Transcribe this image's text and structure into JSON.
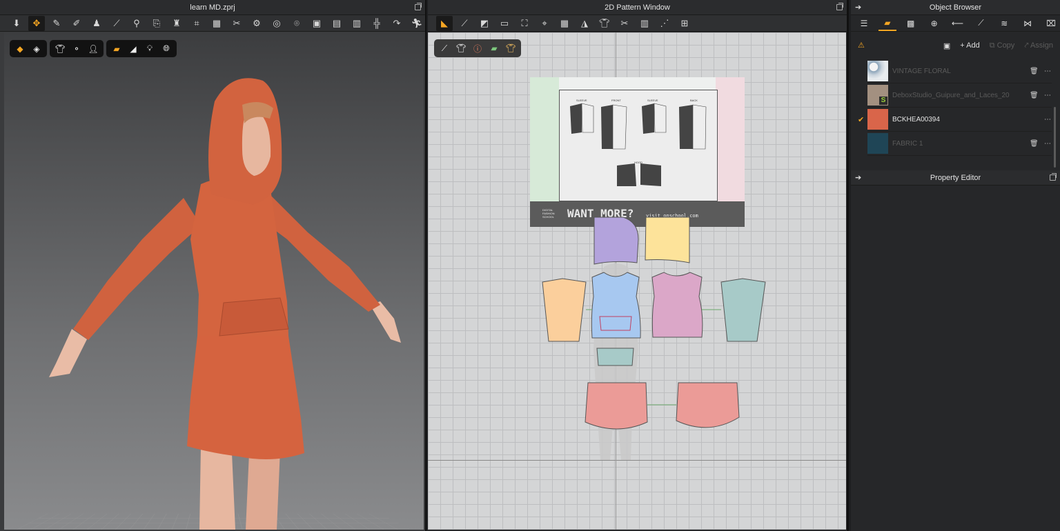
{
  "left_window": {
    "title": "learn MD.zprj"
  },
  "middle_window": {
    "title": "2D Pattern Window"
  },
  "object_browser": {
    "title": "Object Browser",
    "actions": {
      "add": "Add",
      "copy": "Copy",
      "assign": "Assign"
    },
    "fabrics": [
      {
        "name": "VINTAGE FLORAL",
        "color": "#c9d3dc",
        "selected": false
      },
      {
        "name": "DeboxStudio_Guipure_and_Laces_20",
        "color": "#a39080",
        "selected": false
      },
      {
        "name": "BCKHEA00394",
        "color": "#d9654a",
        "selected": true
      },
      {
        "name": "FABRIC 1",
        "color": "#1f4556",
        "selected": false
      }
    ]
  },
  "property_editor": {
    "title": "Property Editor"
  },
  "reference_sheet": {
    "labels": [
      "SLEEVE",
      "FRONT",
      "SLEEVE",
      "BACK",
      "HOOD"
    ],
    "banner": "WANT MORE?",
    "banner_small": "DIGITAL FASHION SCHOOL",
    "url": "visit onschool.com"
  },
  "colors": {
    "accent": "#f5a623",
    "garment": "#d9654a",
    "pattern_purple": "#b3a3dc",
    "pattern_yellow": "#fde39a",
    "pattern_orange": "#fbcf9c",
    "pattern_blue": "#a7c8f0",
    "pattern_pink": "#dba7c8",
    "pattern_teal": "#a7cac8",
    "pattern_red": "#eb9b97"
  }
}
